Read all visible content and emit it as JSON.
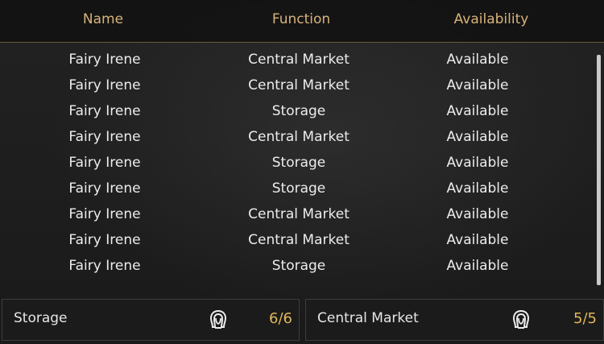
{
  "header": {
    "name_label": "Name",
    "function_label": "Function",
    "availability_label": "Availability"
  },
  "rows": [
    {
      "name": "Fairy Irene",
      "function": "Central Market",
      "availability": "Available"
    },
    {
      "name": "Fairy Irene",
      "function": "Central Market",
      "availability": "Available"
    },
    {
      "name": "Fairy Irene",
      "function": "Storage",
      "availability": "Available"
    },
    {
      "name": "Fairy Irene",
      "function": "Central Market",
      "availability": "Available"
    },
    {
      "name": "Fairy Irene",
      "function": "Storage",
      "availability": "Available"
    },
    {
      "name": "Fairy Irene",
      "function": "Storage",
      "availability": "Available"
    },
    {
      "name": "Fairy Irene",
      "function": "Central Market",
      "availability": "Available"
    },
    {
      "name": "Fairy Irene",
      "function": "Central Market",
      "availability": "Available"
    },
    {
      "name": "Fairy Irene",
      "function": "Storage",
      "availability": "Available"
    }
  ],
  "footer": {
    "storage": {
      "label": "Storage",
      "count": "6/6",
      "icon": "fairy-head-icon"
    },
    "market": {
      "label": "Central Market",
      "count": "5/5",
      "icon": "fairy-head-icon"
    }
  },
  "colors": {
    "header_text": "#d8b37a",
    "count_text": "#e2b65c",
    "row_text": "#ececec"
  }
}
